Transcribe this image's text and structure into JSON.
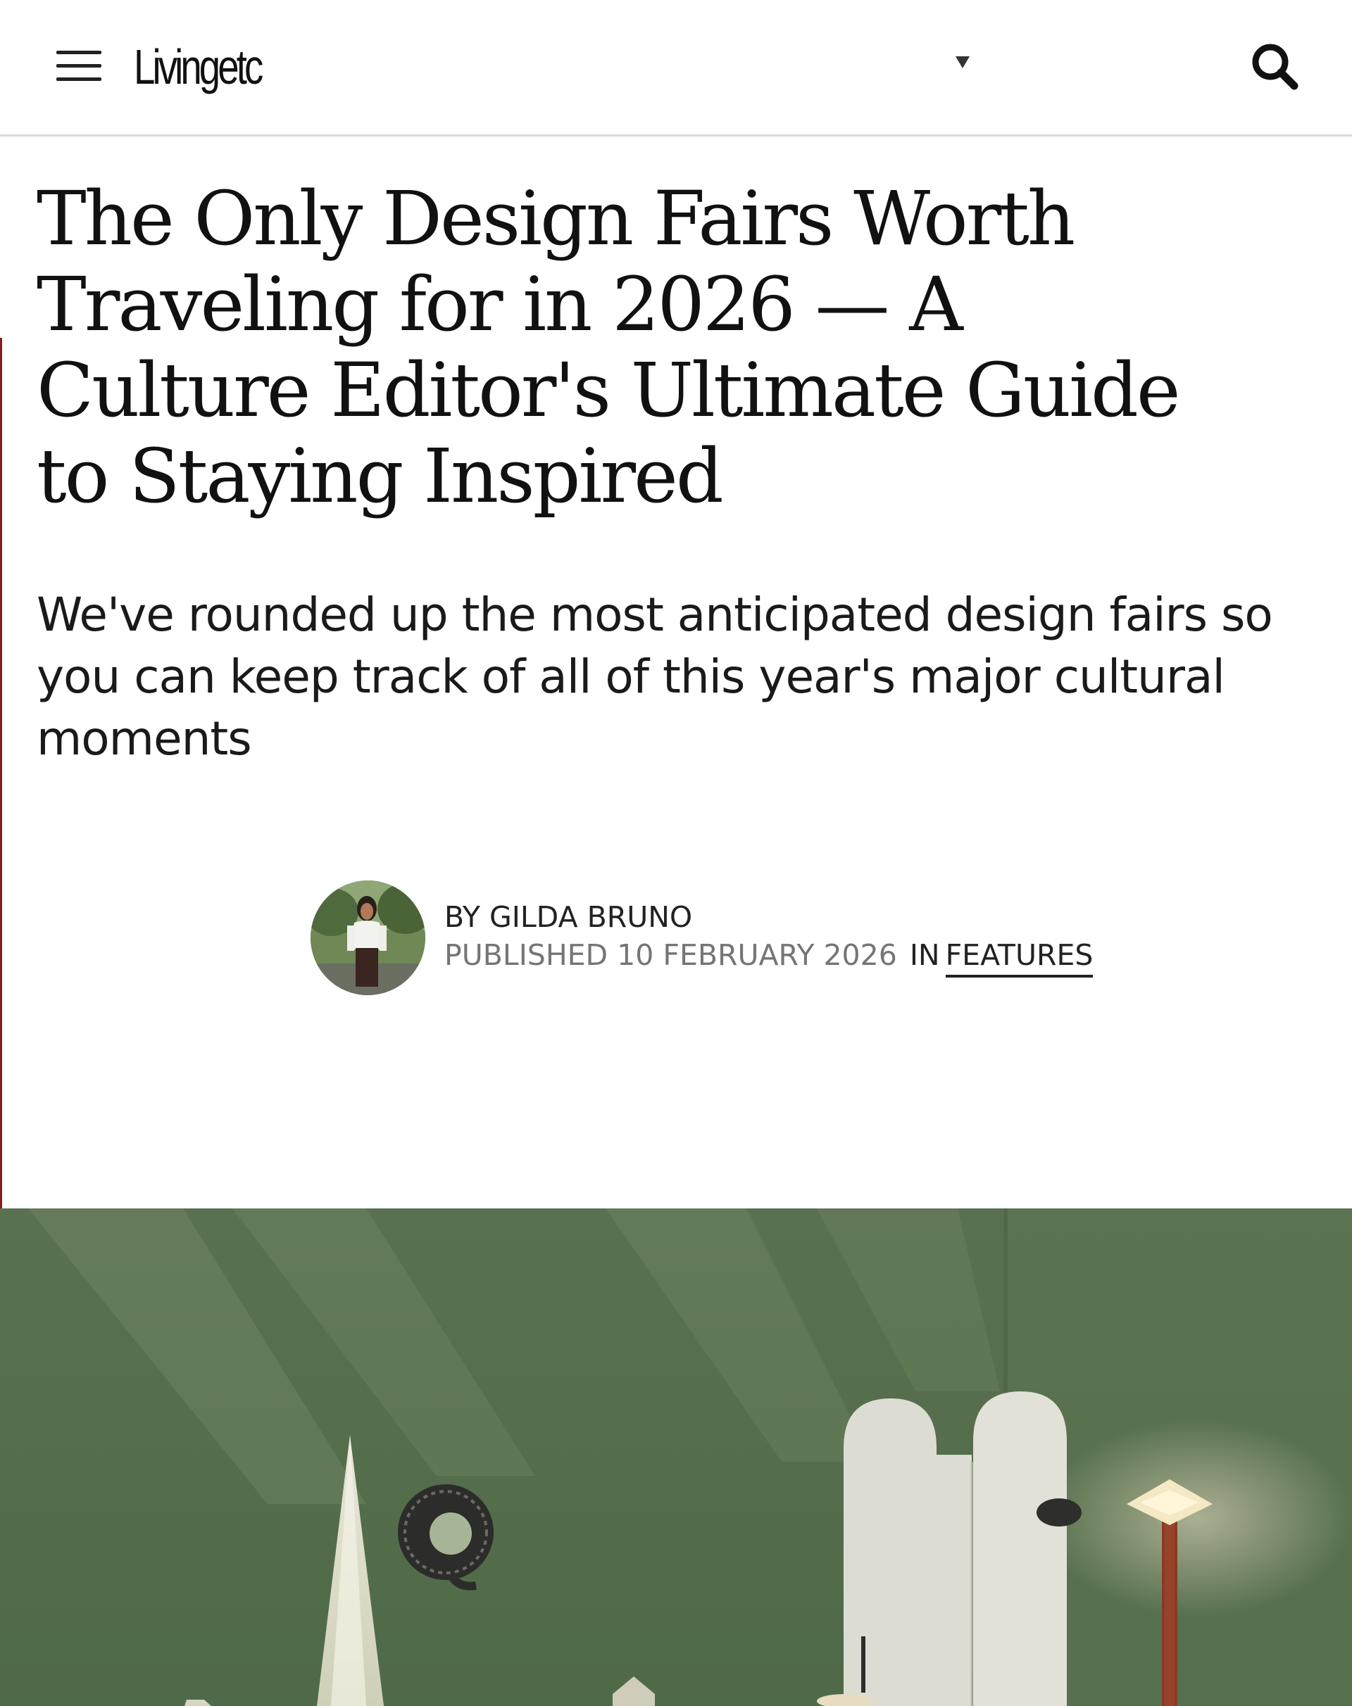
{
  "header": {
    "logo": "Livingetc",
    "menu_icon": "hamburger-menu-icon",
    "dropdown_icon": "caret-down-icon",
    "search_icon": "search-icon"
  },
  "article": {
    "headline": "The Only Design Fairs Worth Traveling for in 2026 — A Culture Editor's Ultimate Guide to Staying Inspired",
    "standfirst": "We've rounded up the most anticipated design fairs so you can keep track of all of this year's major cultural moments",
    "byline": {
      "author": "BY GILDA BRUNO",
      "published": "PUBLISHED 10 FEBRUARY 2026",
      "in_label": "IN",
      "section": "FEATURES"
    }
  },
  "colors": {
    "accent_line": "#8b1a1a",
    "hero_green": "#56704c"
  }
}
